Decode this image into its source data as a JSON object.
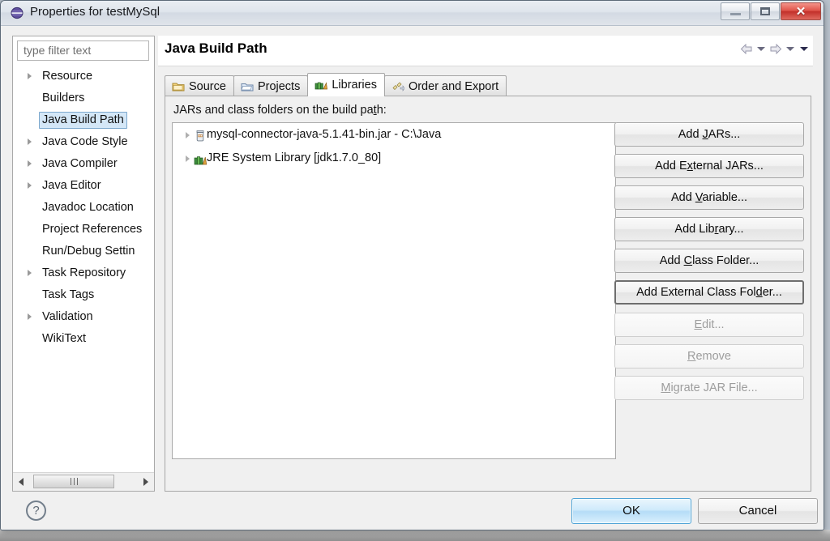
{
  "window": {
    "title": "Properties for testMySql",
    "icon": "eclipse-icon",
    "controls": {
      "minimize": "minimize-button",
      "maximize": "maximize-button",
      "close": "close-button"
    }
  },
  "sidebar": {
    "filter_placeholder": "type filter text",
    "filter_value": "",
    "items": [
      {
        "label": "Resource",
        "expandable": true,
        "selected": false
      },
      {
        "label": "Builders",
        "expandable": false,
        "selected": false
      },
      {
        "label": "Java Build Path",
        "expandable": false,
        "selected": true
      },
      {
        "label": "Java Code Style",
        "expandable": true,
        "selected": false
      },
      {
        "label": "Java Compiler",
        "expandable": true,
        "selected": false
      },
      {
        "label": "Java Editor",
        "expandable": true,
        "selected": false
      },
      {
        "label": "Javadoc Location",
        "expandable": false,
        "selected": false
      },
      {
        "label": "Project References",
        "expandable": false,
        "selected": false
      },
      {
        "label": "Run/Debug Settin",
        "expandable": false,
        "selected": false
      },
      {
        "label": "Task Repository",
        "expandable": true,
        "selected": false
      },
      {
        "label": "Task Tags",
        "expandable": false,
        "selected": false
      },
      {
        "label": "Validation",
        "expandable": true,
        "selected": false
      },
      {
        "label": "WikiText",
        "expandable": false,
        "selected": false
      }
    ]
  },
  "page": {
    "title": "Java Build Path",
    "nav": {
      "back": "back-arrow-icon",
      "back_menu": "chevron-down-icon",
      "forward": "forward-arrow-icon",
      "forward_menu": "chevron-down-icon",
      "view_menu": "chevron-down-icon"
    }
  },
  "tabs": [
    {
      "label": "Source",
      "icon": "source-folder-icon",
      "active": false
    },
    {
      "label": "Projects",
      "icon": "project-folder-icon",
      "active": false
    },
    {
      "label": "Libraries",
      "icon": "libraries-books-icon",
      "active": true
    },
    {
      "label": "Order and Export",
      "icon": "order-export-icon",
      "active": false
    }
  ],
  "libraries_tab": {
    "list_label_pre": "JARs and class folders on the build pa",
    "list_label_mnemonic": "t",
    "list_label_post": "h:",
    "entries": [
      {
        "label": "mysql-connector-java-5.1.41-bin.jar - C:\\Java",
        "icon": "jar-icon",
        "expandable": true
      },
      {
        "label": "JRE System Library [jdk1.7.0_80]",
        "icon": "jre-library-icon",
        "expandable": true
      }
    ],
    "buttons": [
      {
        "pre": "Add ",
        "mnemonic": "J",
        "post": "ARs...",
        "state": "enabled"
      },
      {
        "pre": "Add E",
        "mnemonic": "x",
        "post": "ternal JARs...",
        "state": "enabled"
      },
      {
        "pre": "Add ",
        "mnemonic": "V",
        "post": "ariable...",
        "state": "enabled"
      },
      {
        "pre": "Add Lib",
        "mnemonic": "r",
        "post": "ary...",
        "state": "enabled"
      },
      {
        "pre": "Add ",
        "mnemonic": "C",
        "post": "lass Folder...",
        "state": "enabled"
      },
      {
        "pre": "Add External Class Fol",
        "mnemonic": "d",
        "post": "er...",
        "state": "focused"
      },
      {
        "pre": "",
        "mnemonic": "E",
        "post": "dit...",
        "state": "disabled"
      },
      {
        "pre": "",
        "mnemonic": "R",
        "post": "emove",
        "state": "disabled"
      },
      {
        "pre": "",
        "mnemonic": "M",
        "post": "igrate JAR File...",
        "state": "disabled"
      }
    ]
  },
  "footer": {
    "help": "?",
    "ok_label": "OK",
    "cancel_label": "Cancel"
  },
  "colors": {
    "dialog_bg": "#f0f0f0",
    "selection_blue": "#d4e7f7",
    "default_button_blue": "#b5dcf7",
    "close_red": "#c2302a",
    "disabled_text": "#9d9d9d"
  }
}
